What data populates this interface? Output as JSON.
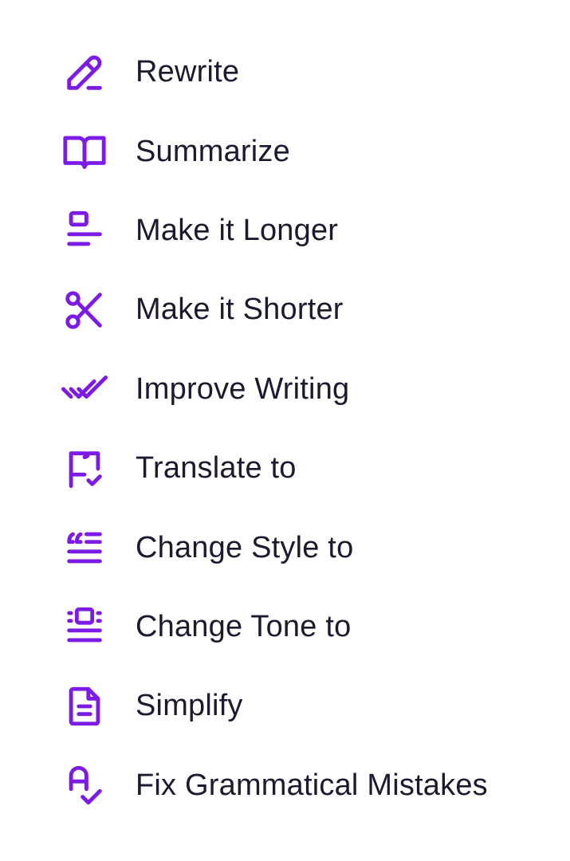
{
  "theme": {
    "accent": "#7c1be6",
    "text": "#1b1a2e",
    "background": "#ffffff"
  },
  "menu": {
    "items": [
      {
        "label": "Rewrite",
        "icon": "pencil-icon"
      },
      {
        "label": "Summarize",
        "icon": "book-open-icon"
      },
      {
        "label": "Make it Longer",
        "icon": "expand-text-icon"
      },
      {
        "label": "Make it Shorter",
        "icon": "scissors-icon"
      },
      {
        "label": "Improve Writing",
        "icon": "double-check-icon"
      },
      {
        "label": "Translate to",
        "icon": "flag-check-icon"
      },
      {
        "label": "Change Style to",
        "icon": "quote-lines-icon"
      },
      {
        "label": "Change Tone to",
        "icon": "tone-lines-icon"
      },
      {
        "label": "Simplify",
        "icon": "document-icon"
      },
      {
        "label": "Fix Grammatical Mistakes",
        "icon": "spell-check-icon"
      }
    ]
  }
}
